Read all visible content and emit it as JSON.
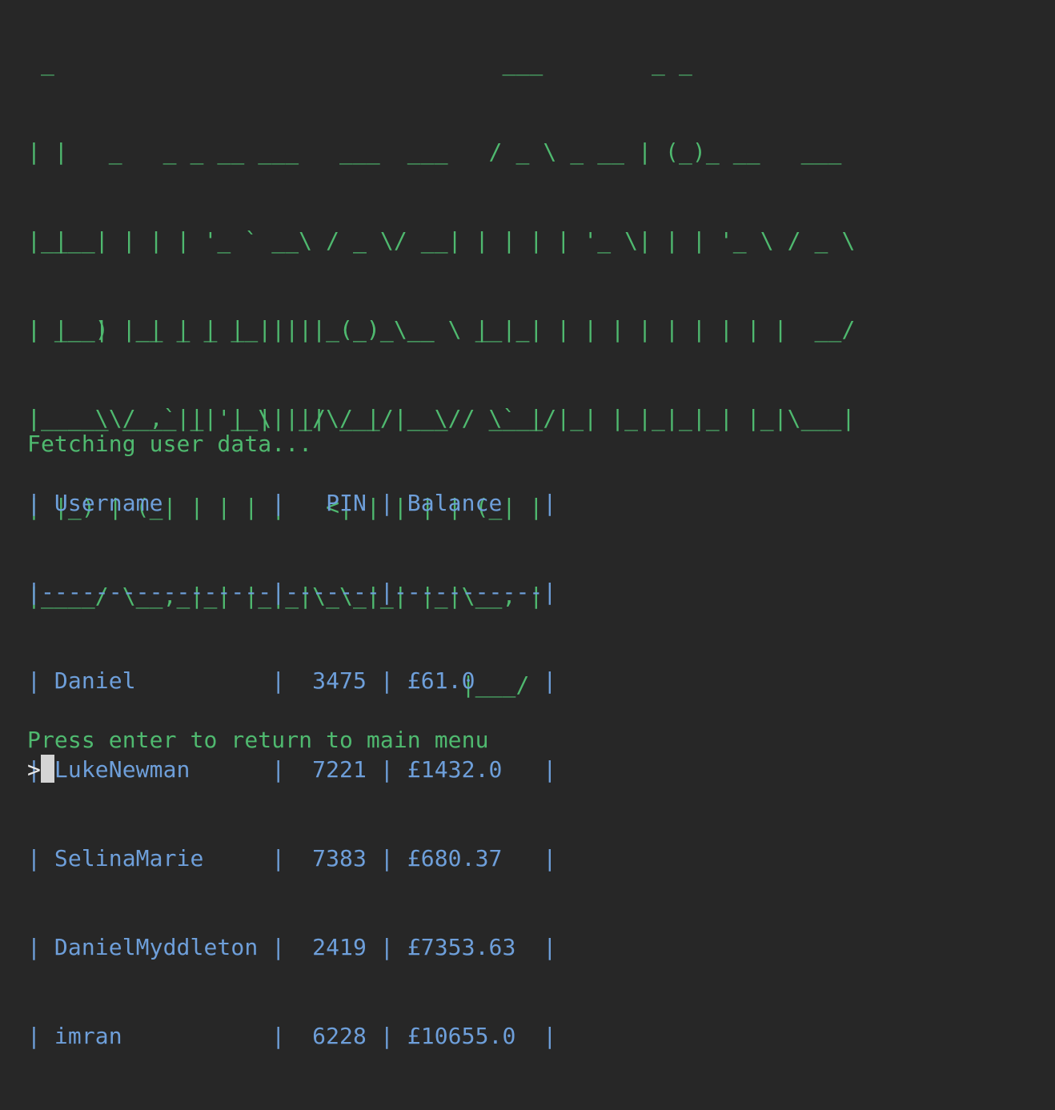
{
  "banner": {
    "title_lines": [
      " _                                 ___        _ _",
      "| |   _   _ _ __ ___   ___  ___   / _ \\ _ __ | (_)_ __   ___",
      "| |  | | | | '_ ` _ \\ / _ \\/ __| | | | | '_ \\| | | '_ \\ / _ \\",
      "| |__| |_| | | | | | | (_) \\__ \\ | |_| | | | | | | | | |  __/",
      "|_____\\__,_|_| |_| |_|\\___/|___/  \\___/|_| |_|_|_|_| |_|\\___|"
    ],
    "subtitle_lines": [
      " ____              _    _",
      "| __ )  __ _ _ __ | | _(_)_ __   __ _",
      "|  _ \\ / _` | '_ \\| |/ / | '_ \\ / _` |",
      "| |_) | (_| | | | |   <| | | | | (_| |",
      "|____/ \\__,_|_| |_|_|\\_\\_|_| |_|\\__, |",
      "                                |___/"
    ]
  },
  "status": {
    "message": "Fetching user data..."
  },
  "table": {
    "header": "| Username        |   PIN | Balance   |",
    "separator": "|-----------------|-------|-----------|",
    "rows": [
      "| Daniel          |  3475 | £61.0     |",
      "| LukeNewman      |  7221 | £1432.0   |",
      "| SelinaMarie     |  7383 | £680.37   |",
      "| DanielMyddleton |  2419 | £7353.63  |",
      "| imran           |  6228 | £10655.0  |"
    ]
  },
  "prompt": {
    "message": "Press enter to return to main menu",
    "caret": ">"
  },
  "colors": {
    "background": "#272727",
    "green": "#4fb96f",
    "blue": "#6e9fda"
  }
}
